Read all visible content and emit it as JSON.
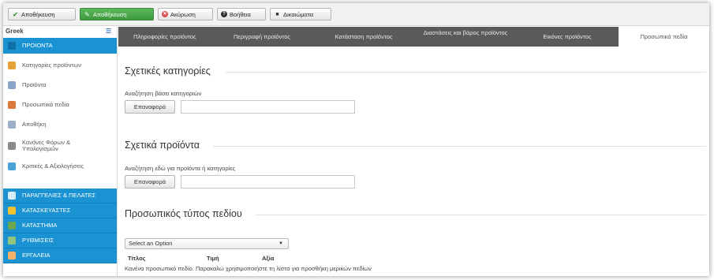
{
  "toolbar": {
    "save": "Αποθήκευση",
    "save_stay": "Αποθήκευση",
    "cancel": "Ακύρωση",
    "help": "Βοήθεια",
    "permissions": "Δικαιώματα"
  },
  "sidebar": {
    "language": "Greek",
    "items": [
      {
        "label": "ΠΡΟΙΟΝΤΑ",
        "icon": "products-icon",
        "color": "#1b93d2"
      },
      {
        "label": "Κατηγορίες προϊόντων",
        "icon": "categories-icon",
        "color": "#e8a23a"
      },
      {
        "label": "Προϊόντα",
        "icon": "product-list-icon",
        "color": "#8aa4c8"
      },
      {
        "label": "Προσωπικά πεδία",
        "icon": "custom-fields-icon",
        "color": "#d97a3a"
      },
      {
        "label": "Αποθήκη",
        "icon": "warehouse-icon",
        "color": "#9bb0c6"
      },
      {
        "label": "Κανόνες Φόρων & Υπολογισμών",
        "icon": "tax-rules-icon",
        "color": "#8a8a8a"
      },
      {
        "label": "Κριτικές & Αξιολογήσεις",
        "icon": "reviews-icon",
        "color": "#4aa3d8"
      },
      {
        "label": "ΠΑΡΑΓΓΕΛΙΕΣ & ΠΕΛΑΤΕΣ",
        "icon": "orders-icon",
        "color": "#ffffff"
      },
      {
        "label": "ΚΑΤΑΣΚΕΥΑΣΤΕΣ",
        "icon": "manufacturers-icon",
        "color": "#f1c232"
      },
      {
        "label": "ΚΑΤΑΣΤΗΜΑ",
        "icon": "store-icon",
        "color": "#6aa84f"
      },
      {
        "label": "ΡΥΘΜΙΣΕΙΣ",
        "icon": "settings-icon",
        "color": "#93c47d"
      },
      {
        "label": "ΕΡΓΑΛΕΙΑ",
        "icon": "tools-icon",
        "color": "#f6b26b"
      }
    ]
  },
  "tabs": [
    {
      "label": "Πληροφορίες προϊόντος"
    },
    {
      "label": "Περιγραφή προϊόντος"
    },
    {
      "label": "Κατάσταση προϊόντος"
    },
    {
      "label": "Διαστάσεις και βάρος προϊόντος"
    },
    {
      "label": "Εικόνες προϊόντος"
    },
    {
      "label": "Προσωπικά πεδία"
    }
  ],
  "sections": {
    "related_categories": {
      "title": "Σχετικές κατηγορίες",
      "search_label": "Αναζήτηση βάσει κατηγοριών",
      "reset": "Επαναφορά",
      "input_value": ""
    },
    "related_products": {
      "title": "Σχετικά προϊόντα",
      "search_label": "Αναζήτηση εδώ για προϊόντα ή κατηγορίες",
      "reset": "Επαναφορά",
      "input_value": ""
    },
    "custom_field_type": {
      "title": "Προσωπικός τύπος πεδίου",
      "select_value": "Select an Option",
      "columns": [
        "Τίτλος",
        "Τιμή",
        "Αξία"
      ],
      "empty_message": "Κανένα προσωπικό πεδίο. Παρακαλώ χρησιμοποιήστε τη λίστα για προσθήκη μερικών πεδίων"
    }
  }
}
